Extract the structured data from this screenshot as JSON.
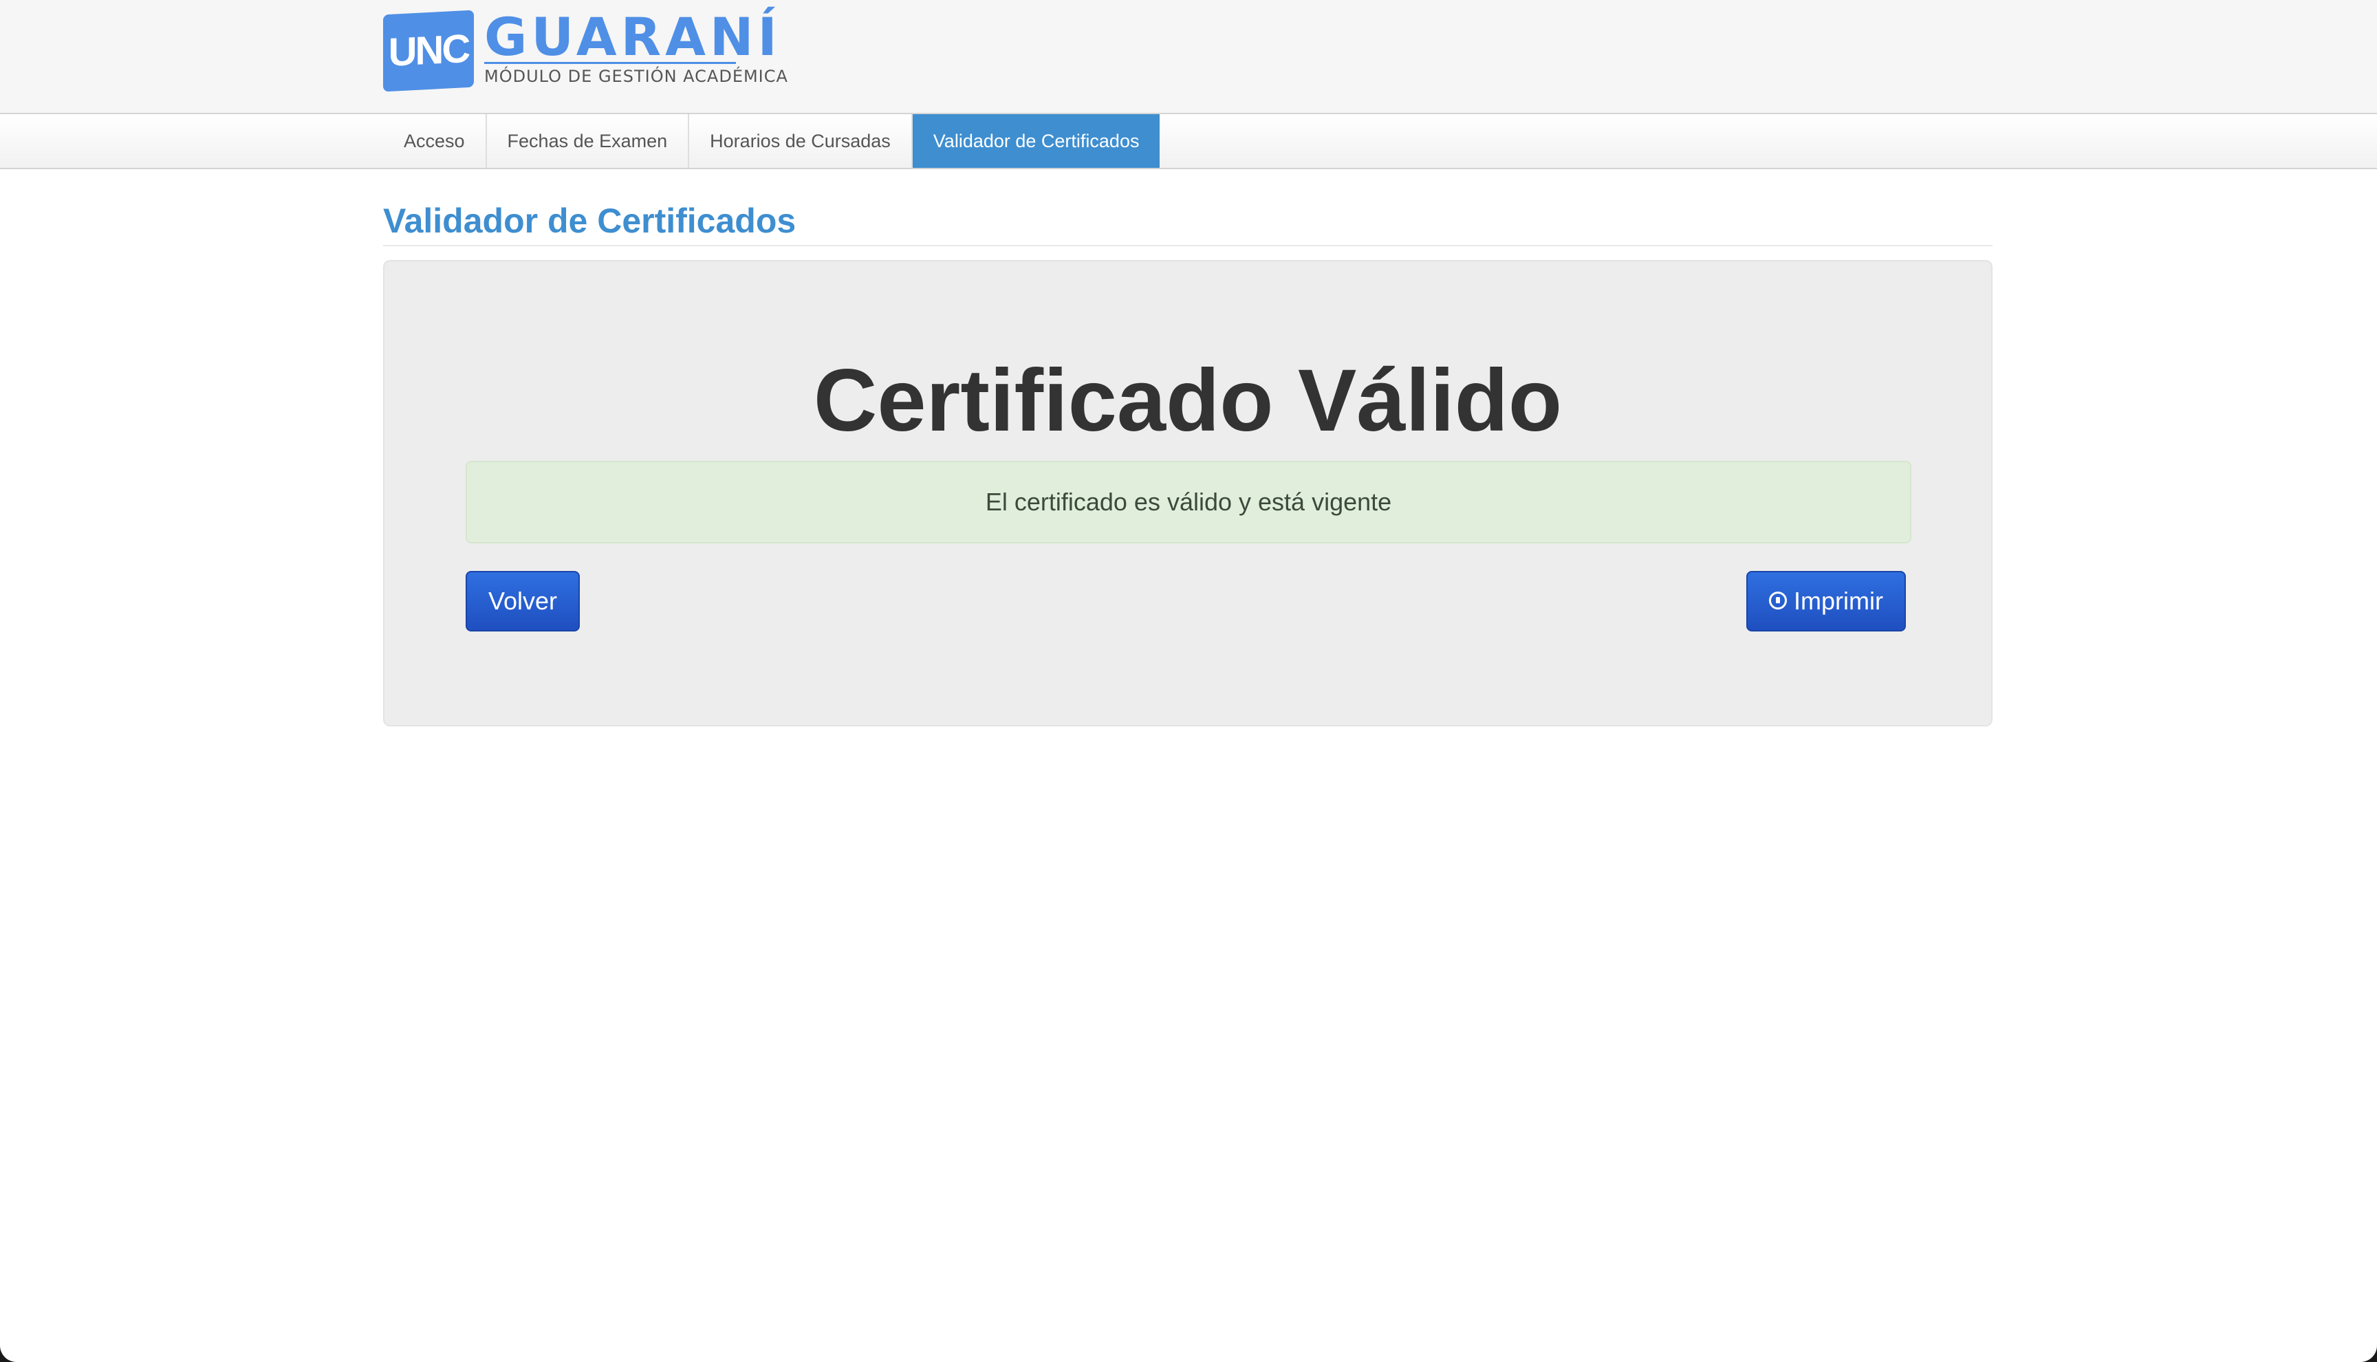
{
  "header": {
    "logo_badge": "UNC",
    "logo_title": "GUARANÍ",
    "logo_subtitle": "MÓDULO DE GESTIÓN ACADÉMICA",
    "brand_color": "#4f8fe6"
  },
  "nav": {
    "items": [
      {
        "label": "Acceso",
        "active": false
      },
      {
        "label": "Fechas de Examen",
        "active": false
      },
      {
        "label": "Horarios de Cursadas",
        "active": false
      },
      {
        "label": "Validador de Certificados",
        "active": true
      }
    ],
    "active_color": "#3e8ed0"
  },
  "main": {
    "page_title": "Validador de Certificados",
    "heading": "Certificado Válido",
    "alert_text": "El certificado es válido y está vigente",
    "alert_color": "#e0eedb",
    "volver_label": "Volver",
    "imprimir_label": "Imprimir",
    "imprimir_icon": "print-icon",
    "button_color": "#2559d0"
  }
}
